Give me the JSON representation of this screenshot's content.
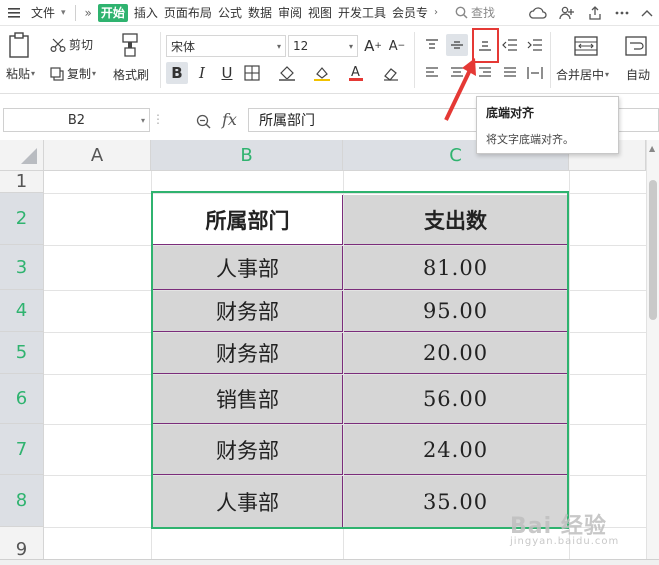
{
  "menubar": {
    "file_label": "文件",
    "tabs": [
      "开始",
      "插入",
      "页面布局",
      "公式",
      "数据",
      "审阅",
      "视图",
      "开发工具",
      "会员专"
    ],
    "search_label": "查找"
  },
  "ribbon": {
    "paste_label": "粘贴",
    "cut_label": "剪切",
    "copy_label": "复制",
    "format_painter_label": "格式刷",
    "font_name": "宋体",
    "font_size": "12",
    "bold_label": "B",
    "italic_label": "I",
    "underline_label": "U",
    "merge_center_label": "合并居中",
    "wrap_label": "自动"
  },
  "tooltip": {
    "title": "底端对齐",
    "description": "将文字底端对齐。"
  },
  "formula_bar": {
    "cell_ref": "B2",
    "fx_label": "fx",
    "content": "所属部门"
  },
  "sheet": {
    "columns": [
      "A",
      "B",
      "C"
    ],
    "rows": [
      "1",
      "2",
      "3",
      "4",
      "5",
      "6",
      "7",
      "8",
      "9"
    ],
    "table": {
      "headers": [
        "所属部门",
        "支出数"
      ],
      "rows": [
        [
          "人事部",
          "81.00"
        ],
        [
          "财务部",
          "95.00"
        ],
        [
          "财务部",
          "20.00"
        ],
        [
          "销售部",
          "56.00"
        ],
        [
          "财务部",
          "24.00"
        ],
        [
          "人事部",
          "35.00"
        ]
      ]
    }
  },
  "colors": {
    "accent_green": "#2fb36f",
    "cell_gray": "#d6d6d6",
    "table_border": "#7b2d7b",
    "annotation_red": "#e53935"
  },
  "watermark": {
    "main": "Bai 经验",
    "sub": "jingyan.baidu.com"
  }
}
